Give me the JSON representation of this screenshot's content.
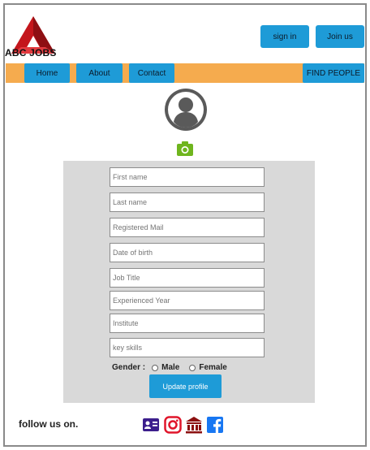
{
  "header": {
    "logo_text": "ABC JOBS",
    "signin_label": "sign in",
    "join_label": "Join us"
  },
  "nav": {
    "items": [
      {
        "label": "Home"
      },
      {
        "label": "About"
      },
      {
        "label": "Contact"
      }
    ],
    "find_people_label": "FIND PEOPLE"
  },
  "profile": {
    "avatar_icon": "user-avatar-icon",
    "camera_icon": "camera-icon"
  },
  "form": {
    "first_name": {
      "placeholder": "First name",
      "value": ""
    },
    "last_name": {
      "placeholder": "Last name",
      "value": ""
    },
    "email": {
      "placeholder": "Registered Mail",
      "value": ""
    },
    "dob": {
      "placeholder": "Date of birth",
      "value": ""
    },
    "job_title": {
      "placeholder": "Job Title",
      "value": ""
    },
    "experienced_year": {
      "placeholder": "Experienced Year",
      "value": ""
    },
    "institute": {
      "placeholder": "Institute",
      "value": ""
    },
    "key_skills": {
      "placeholder": "key skills",
      "value": ""
    },
    "gender_label": "Gender :",
    "gender_options": [
      "Male",
      "Female"
    ],
    "update_label": "Update profile"
  },
  "footer": {
    "follow_label": "follow us on.",
    "icons": [
      "id-card-icon",
      "instagram-icon",
      "institution-icon",
      "facebook-icon"
    ]
  },
  "colors": {
    "accent_blue": "#1e9bd7",
    "nav_orange": "#f5ab4e",
    "panel_gray": "#d9d9d9",
    "camera_green": "#6fb51e",
    "logo_red": "#c4161c",
    "social_purple": "#3c1e8c",
    "social_red": "#e0162b",
    "social_maroon": "#8b0f0f",
    "social_blue": "#1877f2"
  }
}
